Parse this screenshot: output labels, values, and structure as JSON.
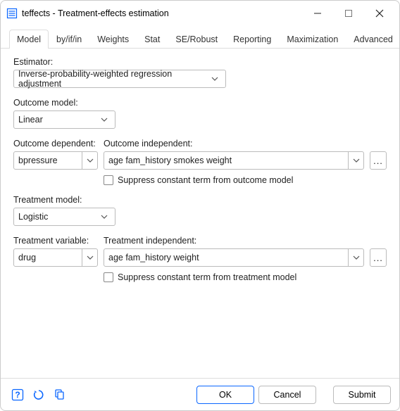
{
  "title": "teffects - Treatment-effects estimation",
  "tabs": [
    {
      "label": "Model",
      "active": true
    },
    {
      "label": "by/if/in",
      "active": false
    },
    {
      "label": "Weights",
      "active": false
    },
    {
      "label": "Stat",
      "active": false
    },
    {
      "label": "SE/Robust",
      "active": false
    },
    {
      "label": "Reporting",
      "active": false
    },
    {
      "label": "Maximization",
      "active": false
    },
    {
      "label": "Advanced",
      "active": false
    }
  ],
  "labels": {
    "estimator": "Estimator:",
    "outcome_model": "Outcome model:",
    "outcome_dependent": "Outcome dependent:",
    "outcome_independent": "Outcome independent:",
    "suppress_outcome": "Suppress constant term from outcome model",
    "treatment_model": "Treatment model:",
    "treatment_variable": "Treatment variable:",
    "treatment_independent": "Treatment independent:",
    "suppress_treatment": "Suppress constant term from treatment model"
  },
  "values": {
    "estimator": "Inverse-probability-weighted regression adjustment",
    "outcome_model": "Linear",
    "outcome_dependent": "bpressure",
    "outcome_independent": "age fam_history smokes weight",
    "treatment_model": "Logistic",
    "treatment_variable": "drug",
    "treatment_independent": "age fam_history weight"
  },
  "buttons": {
    "ok": "OK",
    "cancel": "Cancel",
    "submit": "Submit",
    "more": "..."
  },
  "colors": {
    "accent": "#0a66ff"
  }
}
